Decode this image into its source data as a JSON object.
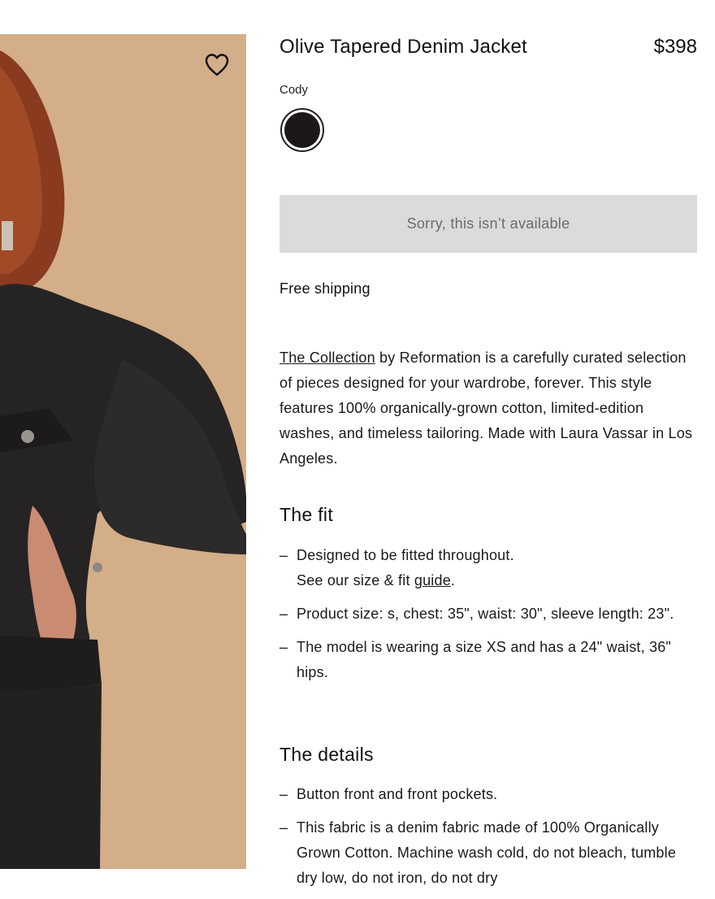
{
  "product": {
    "title": "Olive Tapered Denim Jacket",
    "price": "$398",
    "color_name": "Cody",
    "swatch_color": "#1c1718",
    "unavailable_label": "Sorry, this isn’t available",
    "shipping": "Free shipping",
    "favorite_icon": "heart-outline-icon"
  },
  "description": {
    "link_text": "The Collection",
    "text": " by Reformation is a carefully curated selection of pieces designed for your wardrobe, forever. This style features 100% organically-grown cotton, limited-edition washes, and timeless tailoring. Made with Laura Vassar in Los Angeles."
  },
  "fit": {
    "heading": "The fit",
    "item1_line1": "Designed to be fitted throughout.",
    "item1_line2_prefix": "See our size & fit ",
    "item1_link": "guide",
    "item1_suffix": ".",
    "item2": "Product size: s, chest: 35\", waist: 30\", sleeve length: 23\".",
    "item3": "The model is wearing a size XS and has a 24\" waist, 36\" hips."
  },
  "details": {
    "heading": "The details",
    "item1": "Button front and front pockets.",
    "item2": "This fabric is a denim fabric made of 100% Organically Grown Cotton. Machine wash cold, do not bleach, tumble dry low, do not iron, do not dry"
  },
  "bullet_dash": "–"
}
